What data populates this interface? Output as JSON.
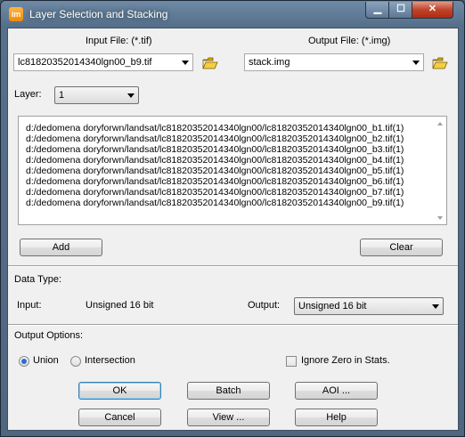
{
  "window": {
    "title": "Layer Selection and Stacking",
    "app_icon_text": "im",
    "controls": [
      "minimize-icon",
      "maximize-icon",
      "close-icon"
    ]
  },
  "input_file": {
    "label": "Input File: (*.tif)",
    "value": "lc81820352014340lgn00_b9.tif"
  },
  "output_file": {
    "label": "Output File: (*.img)",
    "value": "stack.img"
  },
  "layer": {
    "label": "Layer:",
    "value": "1"
  },
  "layer_list": [
    "d:/dedomena doryforwn/landsat/lc81820352014340lgn00/lc81820352014340lgn00_b1.tif(1)",
    "d:/dedomena doryforwn/landsat/lc81820352014340lgn00/lc81820352014340lgn00_b2.tif(1)",
    "d:/dedomena doryforwn/landsat/lc81820352014340lgn00/lc81820352014340lgn00_b3.tif(1)",
    "d:/dedomena doryforwn/landsat/lc81820352014340lgn00/lc81820352014340lgn00_b4.tif(1)",
    "d:/dedomena doryforwn/landsat/lc81820352014340lgn00/lc81820352014340lgn00_b5.tif(1)",
    "d:/dedomena doryforwn/landsat/lc81820352014340lgn00/lc81820352014340lgn00_b6.tif(1)",
    "d:/dedomena doryforwn/landsat/lc81820352014340lgn00/lc81820352014340lgn00_b7.tif(1)",
    "d:/dedomena doryforwn/landsat/lc81820352014340lgn00/lc81820352014340lgn00_b9.tif(1)"
  ],
  "buttons": {
    "add": "Add",
    "clear": "Clear",
    "ok": "OK",
    "batch": "Batch",
    "aoi": "AOI ...",
    "cancel": "Cancel",
    "view": "View ...",
    "help": "Help"
  },
  "data_type": {
    "section_label": "Data Type:",
    "input_label": "Input:",
    "input_value": "Unsigned 16 bit",
    "output_label": "Output:",
    "output_value": "Unsigned 16 bit"
  },
  "output_options": {
    "section_label": "Output Options:",
    "union_label": "Union",
    "intersection_label": "Intersection",
    "selected": "Union",
    "ignore_zero_label": "Ignore Zero in Stats.",
    "ignore_zero_checked": false
  },
  "colors": {
    "accent": "#2b6fd0",
    "window_frame": "#56708c"
  }
}
